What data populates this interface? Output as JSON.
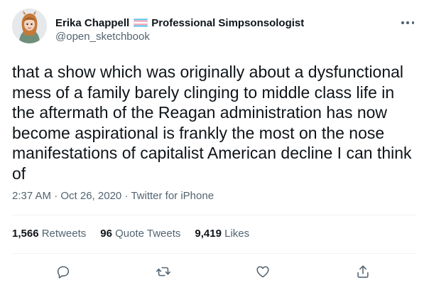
{
  "author": {
    "display_name": "Erika Chappell",
    "name_suffix": "Professional Simpsonsologist",
    "handle": "@open_sketchbook",
    "flag_colors": [
      "#5bcefa",
      "#f5a9b8",
      "#ffffff",
      "#f5a9b8",
      "#5bcefa"
    ]
  },
  "tweet": {
    "text": "that a show which was originally about a dysfunctional mess of a family barely clinging to middle class life in the aftermath of the Reagan administration has now become aspirational is frankly the most on the nose manifestations of capitalist American decline I can think of",
    "meta": "2:37 AM · Oct 26, 2020 · Twitter for iPhone"
  },
  "stats": {
    "retweets": {
      "count": "1,566",
      "label": "Retweets"
    },
    "quote_tweets": {
      "count": "96",
      "label": "Quote Tweets"
    },
    "likes": {
      "count": "9,419",
      "label": "Likes"
    }
  },
  "actions": [
    "reply-icon",
    "retweet-icon",
    "like-icon",
    "share-icon"
  ],
  "colors": {
    "text": "#0f1419",
    "secondary": "#536471",
    "divider": "#eff3f4"
  }
}
